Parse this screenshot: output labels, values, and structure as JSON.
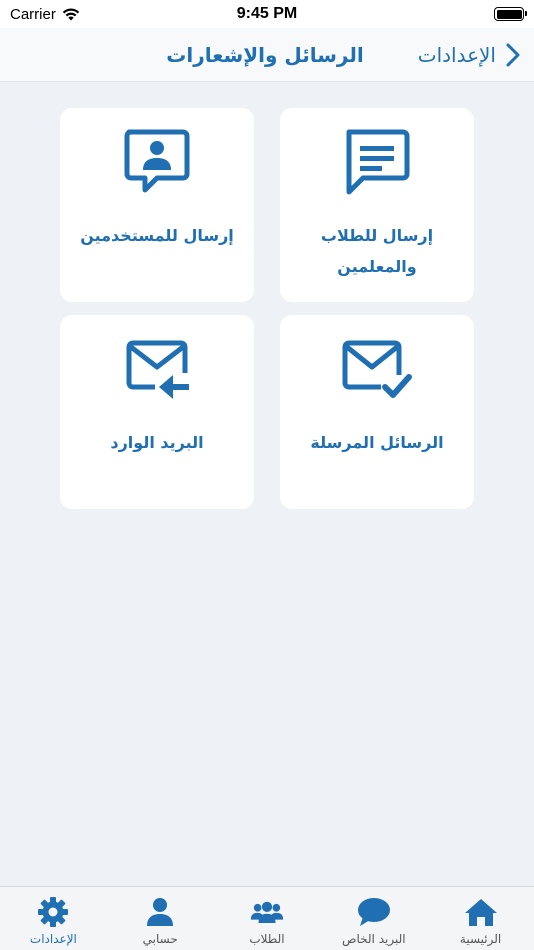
{
  "status_bar": {
    "carrier": "Carrier",
    "time": "9:45 PM"
  },
  "nav": {
    "title": "الرسائل والإشعارات",
    "back_label": "الإعدادات"
  },
  "cards": [
    {
      "id": "send-students-teachers",
      "label": "إرسال للطلاب والمعلمين",
      "icon": "message-lines-icon"
    },
    {
      "id": "send-users",
      "label": "إرسال للمستخدمين",
      "icon": "message-user-icon"
    },
    {
      "id": "sent-messages",
      "label": "الرسائل المرسلة",
      "icon": "mail-check-icon"
    },
    {
      "id": "inbox",
      "label": "البريد الوارد",
      "icon": "mail-inbox-icon"
    }
  ],
  "tabs": [
    {
      "id": "home",
      "label": "الرئيسية",
      "icon": "home-icon",
      "active": false
    },
    {
      "id": "private-mail",
      "label": "البريد الخاص",
      "icon": "chat-bubble-icon",
      "active": false
    },
    {
      "id": "students",
      "label": "الطلاب",
      "icon": "users-group-icon",
      "active": false
    },
    {
      "id": "account",
      "label": "حسابي",
      "icon": "user-icon",
      "active": false
    },
    {
      "id": "settings",
      "label": "الإعدادات",
      "icon": "gear-icon",
      "active": true
    }
  ],
  "colors": {
    "accent": "#1f6fb2",
    "background": "#eef1f6",
    "card": "#ffffff",
    "tab_inactive_label": "#555555"
  }
}
